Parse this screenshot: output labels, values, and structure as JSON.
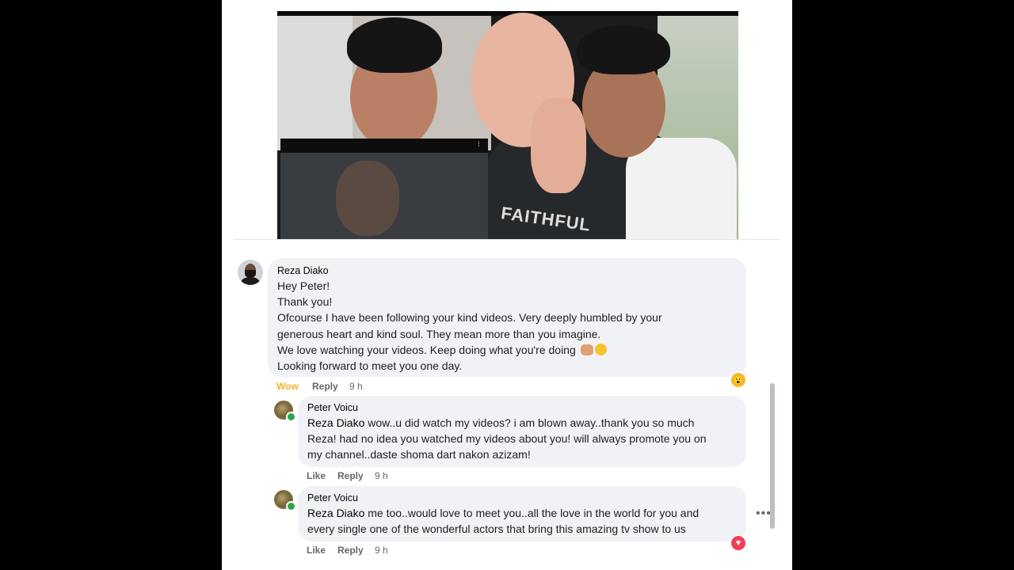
{
  "comment1": {
    "author": "Reza Diako",
    "lines": [
      "Hey Peter!",
      "Thank you!",
      "Ofcourse I have been following your kind videos. Very deeply humbled by your",
      "generous heart and kind soul. They mean more than you imagine.",
      "We love watching your videos. Keep doing what you're doing",
      "Looking forward to meet you one day."
    ],
    "reaction_label": "Wow",
    "reply_label": "Reply",
    "time": "9 h",
    "reaction_icon": "wow-reaction-icon"
  },
  "reply1": {
    "author": "Peter Voicu",
    "mention": "Reza Diako",
    "lines": [
      "wow..u did watch my videos? i am blown away..thank you so much",
      "Reza! had no idea you watched my videos about you! will always promote you on",
      "my channel..daste shoma dart nakon azizam!"
    ],
    "like_label": "Like",
    "reply_label": "Reply",
    "time": "9 h"
  },
  "reply2": {
    "author": "Peter Voicu",
    "mention": "Reza Diako",
    "lines": [
      "me too..would love to meet you..all the love in the world for you and",
      "every single one of the wonderful actors that bring this amazing tv show to us"
    ],
    "like_label": "Like",
    "reply_label": "Reply",
    "time": "9 h",
    "reaction_icon": "love-reaction-icon"
  },
  "media": {
    "shirt_text": "FAITHFUL"
  },
  "colors": {
    "wow": "#f7b125",
    "love": "#f33e58",
    "bubble": "#f0f2f5",
    "meta": "#65676b"
  }
}
